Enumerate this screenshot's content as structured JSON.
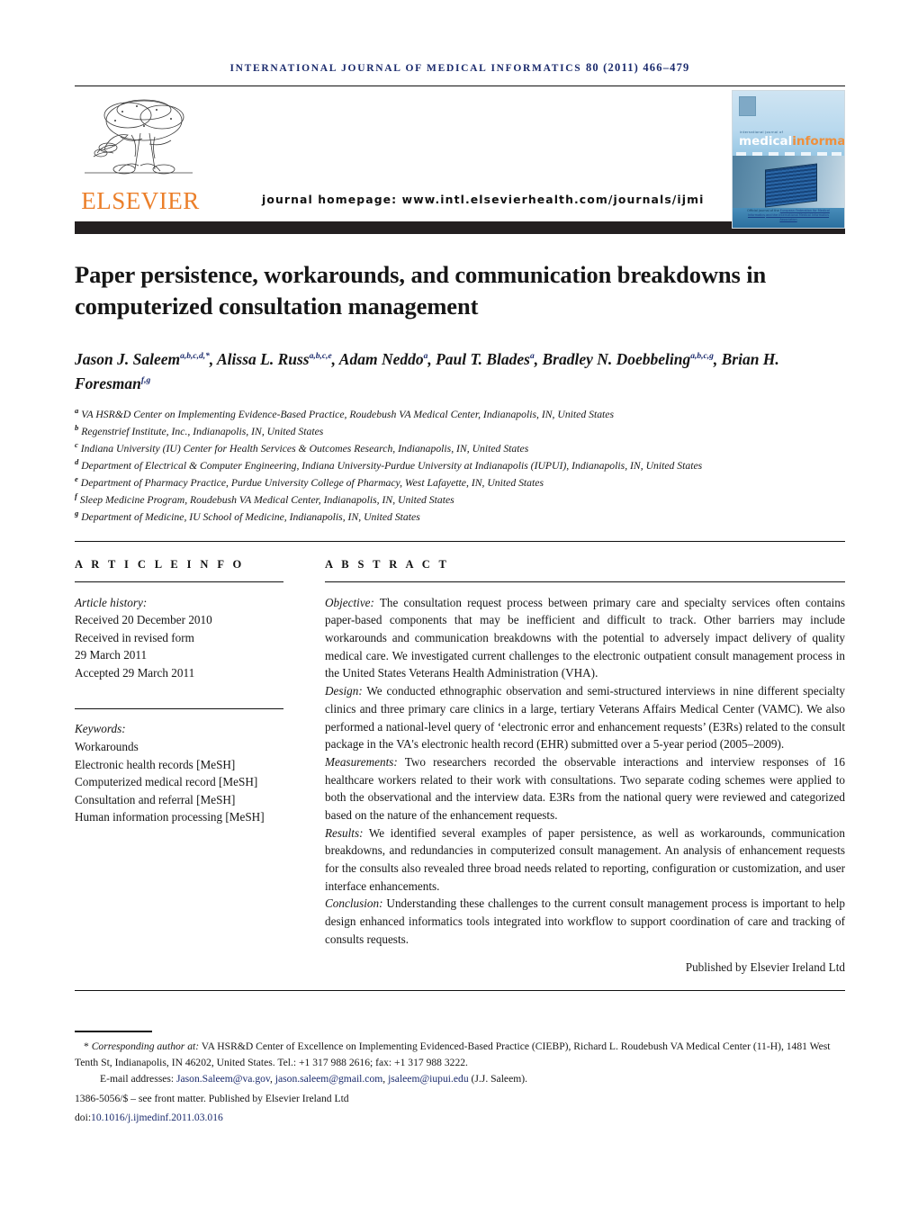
{
  "running_head": {
    "journal": "INTERNATIONAL JOURNAL OF MEDICAL INFORMATICS",
    "volume_info": "80 (2011) 466–479"
  },
  "masthead": {
    "publisher_name": "ELSEVIER",
    "publisher_logo_alt": "elsevier-tree-logo",
    "homepage_label": "journal homepage: www.intl.elsevierhealth.com/journals/ijmi",
    "cover": {
      "superline": "international journal of",
      "title_part1": "medical",
      "title_part2": "informatics",
      "footline_1": "Official journal of the",
      "footline_2": "European Federation for Medical Informatics",
      "footline_3": "and the International Medical Informatics Association"
    },
    "accent_color": "#eb7f2a",
    "bar_color": "#231f20"
  },
  "article": {
    "title": "Paper persistence, workarounds, and communication breakdowns in computerized consultation management",
    "authors_line_1": "Jason J. Saleem",
    "authors": [
      {
        "name": "Jason J. Saleem",
        "sup": "a,b,c,d,*",
        "sep": ", "
      },
      {
        "name": "Alissa L. Russ",
        "sup": "a,b,c,e",
        "sep": ", "
      },
      {
        "name": "Adam Neddo",
        "sup": "a",
        "sep": ", "
      },
      {
        "name": "Paul T. Blades",
        "sup": "a",
        "sep": ", "
      },
      {
        "name": "Bradley N. Doebbeling",
        "sup": "a,b,c,g",
        "sep": ", "
      },
      {
        "name": "Brian H. Foresman",
        "sup": "f,g",
        "sep": ""
      }
    ],
    "affiliations": [
      {
        "label": "a",
        "text": "VA HSR&D Center on Implementing Evidence-Based Practice, Roudebush VA Medical Center, Indianapolis, IN, United States"
      },
      {
        "label": "b",
        "text": "Regenstrief Institute, Inc., Indianapolis, IN, United States"
      },
      {
        "label": "c",
        "text": "Indiana University (IU) Center for Health Services & Outcomes Research, Indianapolis, IN, United States"
      },
      {
        "label": "d",
        "text": "Department of Electrical & Computer Engineering, Indiana University-Purdue University at Indianapolis (IUPUI), Indianapolis, IN, United States"
      },
      {
        "label": "e",
        "text": "Department of Pharmacy Practice, Purdue University College of Pharmacy, West Lafayette, IN, United States"
      },
      {
        "label": "f",
        "text": "Sleep Medicine Program, Roudebush VA Medical Center, Indianapolis, IN, United States"
      },
      {
        "label": "g",
        "text": "Department of Medicine, IU School of Medicine, Indianapolis, IN, United States"
      }
    ]
  },
  "article_info": {
    "heading": "A R T I C L E   I N F O",
    "history_label": "Article history:",
    "history": [
      "Received 20 December 2010",
      "Received in revised form",
      "29 March 2011",
      "Accepted 29 March 2011"
    ],
    "keywords_label": "Keywords:",
    "keywords": [
      "Workarounds",
      "Electronic health records [MeSH]",
      "Computerized medical record [MeSH]",
      "Consultation and referral [MeSH]",
      "Human information processing [MeSH]"
    ]
  },
  "abstract": {
    "heading": "A B S T R A C T",
    "sections": [
      {
        "lead": "Objective:",
        "body": " The consultation request process between primary care and specialty services often contains paper-based components that may be inefficient and difficult to track. Other barriers may include workarounds and communication breakdowns with the potential to adversely impact delivery of quality medical care. We investigated current challenges to the electronic outpatient consult management process in the United States Veterans Health Administration (VHA)."
      },
      {
        "lead": "Design:",
        "body": " We conducted ethnographic observation and semi-structured interviews in nine different specialty clinics and three primary care clinics in a large, tertiary Veterans Affairs Medical Center (VAMC). We also performed a national-level query of ‘electronic error and enhancement requests’ (E3Rs) related to the consult package in the VA's electronic health record (EHR) submitted over a 5-year period (2005–2009)."
      },
      {
        "lead": "Measurements:",
        "body": " Two researchers recorded the observable interactions and interview responses of 16 healthcare workers related to their work with consultations. Two separate coding schemes were applied to both the observational and the interview data. E3Rs from the national query were reviewed and categorized based on the nature of the enhancement requests."
      },
      {
        "lead": "Results:",
        "body": " We identified several examples of paper persistence, as well as workarounds, communication breakdowns, and redundancies in computerized consult management. An analysis of enhancement requests for the consults also revealed three broad needs related to reporting, configuration or customization, and user interface enhancements."
      },
      {
        "lead": "Conclusion:",
        "body": " Understanding these challenges to the current consult management process is important to help design enhanced informatics tools integrated into workflow to support coordination of care and tracking of consults requests."
      }
    ],
    "published_by": "Published by Elsevier Ireland Ltd"
  },
  "footnotes": {
    "corresponding_marker": "*",
    "corresponding_lead": "Corresponding author at:",
    "corresponding_text": " VA HSR&D Center of Excellence on Implementing Evidenced-Based Practice (CIEBP), Richard L. Roudebush VA Medical Center (11-H), 1481 West Tenth St, Indianapolis, IN 46202, United States. Tel.: +1 317 988 2616; fax: +1 317 988 3222.",
    "email_label": "E-mail addresses:",
    "emails": [
      "Jason.Saleem@va.gov",
      "jason.saleem@gmail.com",
      "jsaleem@iupui.edu"
    ],
    "email_attribution": "(J.J. Saleem).",
    "issn_line": "1386-5056/$ – see front matter. Published by Elsevier Ireland Ltd",
    "doi_label": "doi:",
    "doi_value": "10.1016/j.ijmedinf.2011.03.016"
  }
}
